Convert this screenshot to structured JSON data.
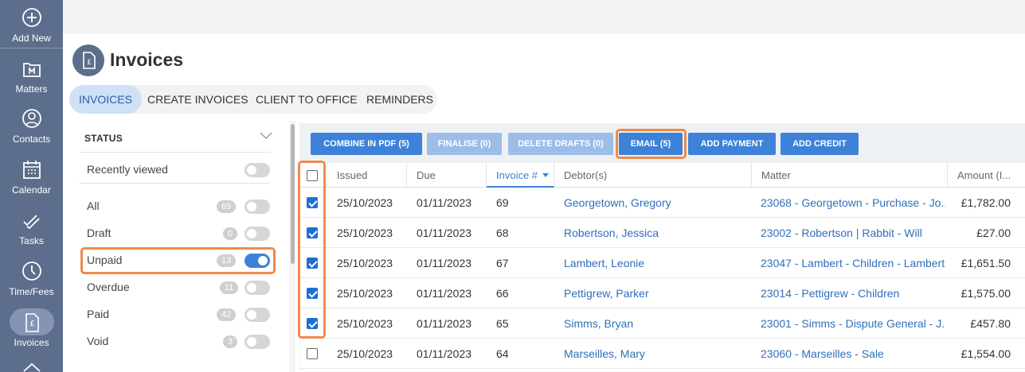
{
  "sidebar": {
    "items": [
      {
        "label": "Add New",
        "icon": "plus-circle-icon"
      },
      {
        "label": "Matters",
        "icon": "matters-icon"
      },
      {
        "label": "Contacts",
        "icon": "contacts-icon"
      },
      {
        "label": "Calendar",
        "icon": "calendar-icon"
      },
      {
        "label": "Tasks",
        "icon": "tasks-icon"
      },
      {
        "label": "Time/Fees",
        "icon": "clock-icon"
      },
      {
        "label": "Invoices",
        "icon": "invoice-icon"
      }
    ]
  },
  "header": {
    "title": "Invoices",
    "icon": "invoice-icon"
  },
  "tabs": [
    {
      "label": "INVOICES",
      "active": true
    },
    {
      "label": "CREATE INVOICES",
      "active": false
    },
    {
      "label": "CLIENT TO OFFICE",
      "active": false
    },
    {
      "label": "REMINDERS",
      "active": false
    }
  ],
  "filters": {
    "heading": "STATUS",
    "recently_viewed": {
      "label": "Recently viewed",
      "on": false
    },
    "items": [
      {
        "label": "All",
        "count": "69",
        "on": false
      },
      {
        "label": "Draft",
        "count": "0",
        "on": false
      },
      {
        "label": "Unpaid",
        "count": "13",
        "on": true
      },
      {
        "label": "Overdue",
        "count": "11",
        "on": false
      },
      {
        "label": "Paid",
        "count": "42",
        "on": false
      },
      {
        "label": "Void",
        "count": "3",
        "on": false
      }
    ]
  },
  "toolbar": {
    "combine": "COMBINE IN PDF (5)",
    "finalise": "FINALISE (0)",
    "delete_drafts": "DELETE DRAFTS (0)",
    "email": "EMAIL (5)",
    "add_payment": "ADD PAYMENT",
    "add_credit": "ADD CREDIT"
  },
  "table": {
    "columns": [
      "Issued",
      "Due",
      "Invoice #",
      "Debtor(s)",
      "Matter",
      "Amount (I..."
    ],
    "rows": [
      {
        "checked": true,
        "issued": "25/10/2023",
        "due": "01/11/2023",
        "invoice": "69",
        "debtor": "Georgetown, Gregory",
        "matter": "23068 - Georgetown - Purchase - Jo...",
        "amount": "£1,782.00"
      },
      {
        "checked": true,
        "issued": "25/10/2023",
        "due": "01/11/2023",
        "invoice": "68",
        "debtor": "Robertson, Jessica",
        "matter": "23002 - Robertson | Rabbit - Will",
        "amount": "£27.00"
      },
      {
        "checked": true,
        "issued": "25/10/2023",
        "due": "01/11/2023",
        "invoice": "67",
        "debtor": "Lambert, Leonie",
        "matter": "23047 - Lambert - Children - Lambert",
        "amount": "£1,651.50"
      },
      {
        "checked": true,
        "issued": "25/10/2023",
        "due": "01/11/2023",
        "invoice": "66",
        "debtor": "Pettigrew, Parker",
        "matter": "23014 - Pettigrew - Children",
        "amount": "£1,575.00"
      },
      {
        "checked": true,
        "issued": "25/10/2023",
        "due": "01/11/2023",
        "invoice": "65",
        "debtor": "Simms, Bryan",
        "matter": "23001 - Simms - Dispute General - J...",
        "amount": "£457.80"
      },
      {
        "checked": false,
        "issued": "25/10/2023",
        "due": "01/11/2023",
        "invoice": "64",
        "debtor": "Marseilles, Mary",
        "matter": "23060 - Marseilles - Sale",
        "amount": "£1,554.00"
      }
    ]
  },
  "colors": {
    "sidebar": "#5d6e8c",
    "accent": "#3d82d8",
    "highlight": "#f08a4b",
    "link": "#2f6fb9"
  }
}
